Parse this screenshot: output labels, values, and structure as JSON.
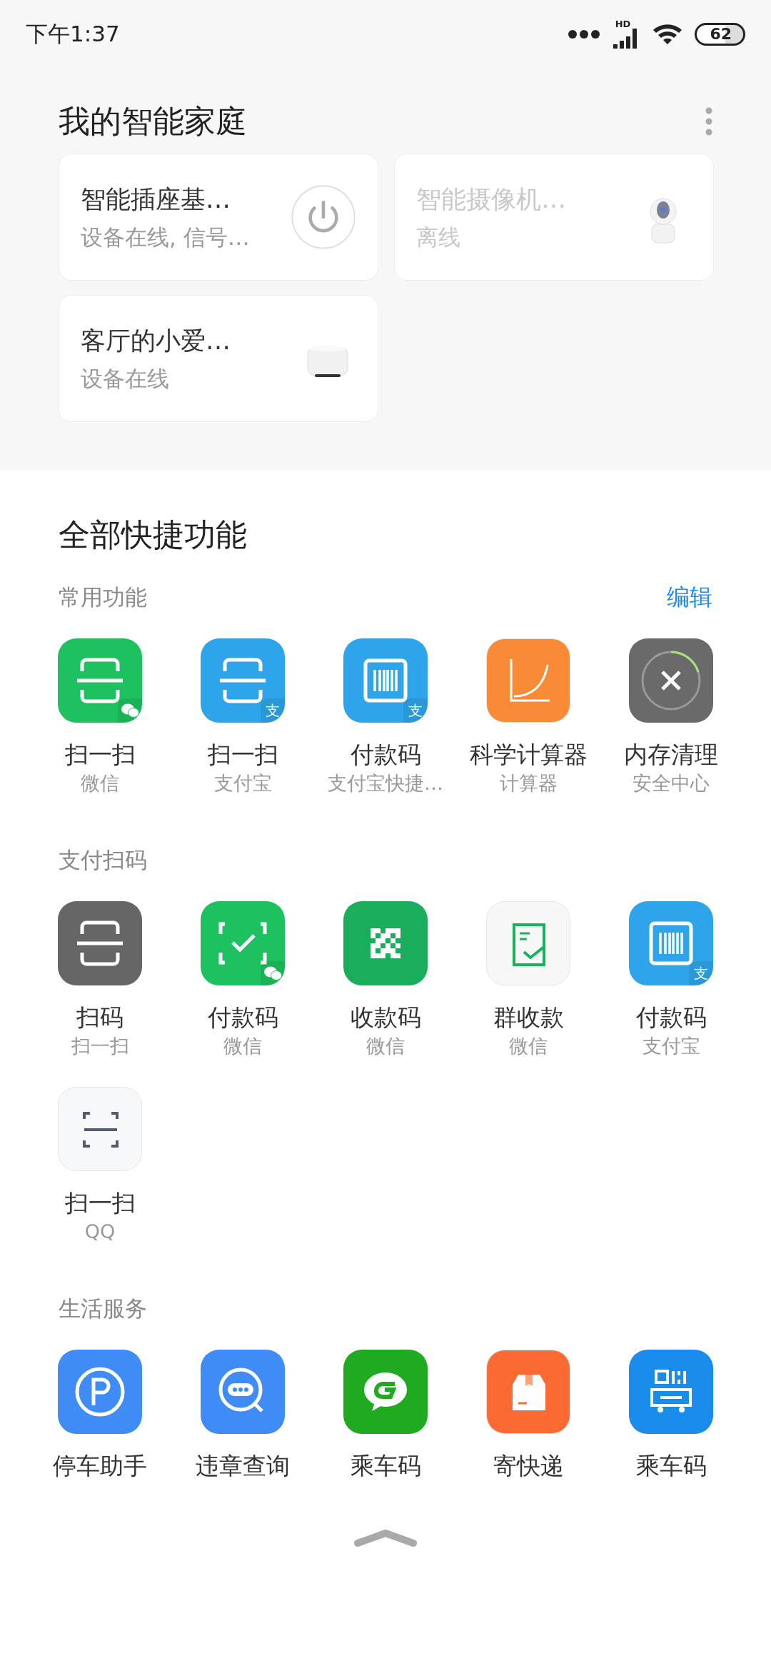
{
  "status_bar": {
    "time": "下午1:37",
    "network": "HD",
    "battery": "62"
  },
  "home": {
    "title": "我的智能家庭",
    "devices": [
      {
        "name": "智能插座基…",
        "status": "设备在线, 信号…",
        "online": true,
        "kind": "plug"
      },
      {
        "name": "智能摄像机…",
        "status": "离线",
        "online": false,
        "kind": "camera"
      },
      {
        "name": "客厅的小爱…",
        "status": "设备在线",
        "online": true,
        "kind": "speaker"
      }
    ]
  },
  "shortcuts": {
    "title": "全部快捷功能",
    "sections": [
      {
        "title": "常用功能",
        "action": "编辑",
        "items": [
          {
            "label": "扫一扫",
            "sublabel": "微信",
            "color": "#1ec15f",
            "badge": {
              "kind": "wechat"
            }
          },
          {
            "label": "扫一扫",
            "sublabel": "支付宝",
            "color": "#2ea5ea",
            "badge": {
              "kind": "alipay",
              "text": "支"
            }
          },
          {
            "label": "付款码",
            "sublabel": "支付宝快捷…",
            "color": "#2ea5ea",
            "badge": {
              "kind": "alipay",
              "text": "支"
            }
          },
          {
            "label": "科学计算器",
            "sublabel": "计算器",
            "color": "#f98a36"
          },
          {
            "label": "内存清理",
            "sublabel": "安全中心",
            "color": "#6a6a6a"
          }
        ]
      },
      {
        "title": "支付扫码",
        "items": [
          {
            "label": "扫码",
            "sublabel": "扫一扫",
            "color": "#666666"
          },
          {
            "label": "付款码",
            "sublabel": "微信",
            "color": "#1ec15f",
            "badge": {
              "kind": "wechat"
            }
          },
          {
            "label": "收款码",
            "sublabel": "微信",
            "color": "#1aae5c"
          },
          {
            "label": "群收款",
            "sublabel": "微信",
            "color": "#f7f7f7"
          },
          {
            "label": "付款码",
            "sublabel": "支付宝",
            "color": "#2ea5ea",
            "badge": {
              "kind": "alipay",
              "text": "支"
            }
          },
          {
            "label": "扫一扫",
            "sublabel": "QQ",
            "color": "#f7f8fa"
          }
        ]
      },
      {
        "title": "生活服务",
        "items": [
          {
            "label": "停车助手",
            "color": "#3f8cf6"
          },
          {
            "label": "违章查询",
            "color": "#3f8cf6"
          },
          {
            "label": "乘车码",
            "color": "#1faa1f"
          },
          {
            "label": "寄快递",
            "color": "#fb6a33"
          },
          {
            "label": "乘车码",
            "color": "#1a8cec"
          }
        ]
      }
    ]
  }
}
